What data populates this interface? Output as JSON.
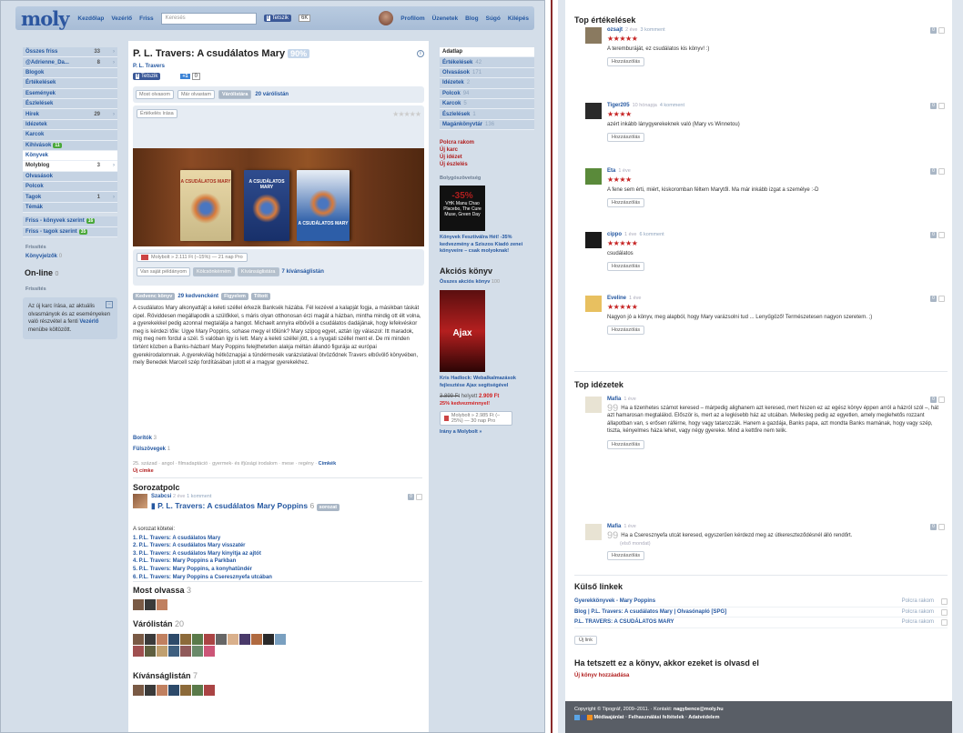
{
  "left": {
    "topbar": {
      "logo": "moly",
      "links": [
        "Kezdőlap",
        "Vezérlő",
        "Friss"
      ],
      "search_placeholder": "Keresés",
      "tetszik": "Tetszik",
      "count": "6K",
      "profile": "Profilom",
      "right_links": [
        "Üzenetek",
        "Blog",
        "Súgó",
        "Kilépés"
      ]
    },
    "sidebar": {
      "items": [
        {
          "label": "Összes friss",
          "n": "33"
        },
        {
          "label": "@Adrienne_Da...",
          "n": "8"
        },
        {
          "label": "Blogok",
          "n": ""
        },
        {
          "label": "Értékelések",
          "n": ""
        },
        {
          "label": "Események",
          "n": ""
        },
        {
          "label": "Észlelések",
          "n": ""
        },
        {
          "label": "Hírek",
          "n": "29"
        },
        {
          "label": "Idézetek",
          "n": ""
        },
        {
          "label": "Karcok",
          "n": ""
        },
        {
          "label": "Kihívások",
          "n": "",
          "badge": "11"
        },
        {
          "label": "Könyvek",
          "n": "",
          "hi": true
        },
        {
          "label": "Molyblog",
          "n": "3",
          "white": true
        },
        {
          "label": "Olvasások",
          "n": ""
        },
        {
          "label": "Polcok",
          "n": ""
        },
        {
          "label": "Tagok",
          "n": "1"
        },
        {
          "label": "Témák",
          "n": ""
        }
      ],
      "extra": [
        {
          "label": "Friss - könyvek szerint",
          "badge": "16"
        },
        {
          "label": "Friss - tagok szerint",
          "badge": "35"
        }
      ],
      "friends_head": "Frissítés",
      "konyvjelzok": "Könyvjelzők",
      "konyvjelzok_n": "0",
      "online": "On-line",
      "online_n": "0",
      "friends_head2": "Frissítés",
      "info": "Az új karc írása, az aktuális olvasmányok és az eseményeken való részvétel a fenti",
      "info_link": "Vezérlő",
      "info_end": "menübe költözött."
    },
    "book": {
      "title": "P. L. Travers: A csudálatos Mary",
      "pct": "90%",
      "author": "P. L. Travers",
      "tetszik": "Tetszik",
      "gplus": "+1",
      "gcount": "0",
      "status_btns": [
        "Most olvasom",
        "Már olvastam",
        "Várólistára"
      ],
      "varolistan": "20 várólistán",
      "rate_btn": "Értékelés írása",
      "book_titles": [
        "A CSUDÁLATOS MARY",
        "A CSUDÁLATOS MARY",
        "A CSUDÁLATOS MARY"
      ],
      "molybolt": "Molybolt » 2.111 Ft (–15%) — 21 nap Pro",
      "own_btns": [
        "Van saját példányom",
        "Kölcsönkérném",
        "Kívánságlistára"
      ],
      "kivansag": "7 kívánságlistán",
      "tags": [
        "Kedvenc könyv",
        "29 kedvencként",
        "Figyelem",
        "Tiltott"
      ],
      "desc": "A csudálatos Mary alkonyattájt a keleti széllel érkezik Banksék házába. Fél kezével a kalapját fogja, a másikban táskát cipel. Röviddesen megállapodik a szülőkkel, s máris olyan otthonosan érzi magát a házban, mintha mindig ott élt volna, a gyerekekkel pedig azonnal megtalálja a hangot. Michaelt annyira elbűvöli a csudálatos dadájának, hogy lefekvéskor meg is kérdezi tőle: Ugye Mary Poppins, sohase megy el tőlünk? Mary szipog egyet, aztán így válaszol: Itt maradok, míg meg nem fordul a szél. S valóban így is lett. Mary a keleti széllel jött, s a nyugati széllel ment el. De mi minden történt közben a Banks-házban! Mary Poppins felejthetetlen alakja méltán állandó figurája az európai gyerekirodalomnak. A gyerekvilág hétköznapjai a tündérmesék varázslatával ötvöződnek Travers elbűvölő könyvében, mely Benedek Marcell szép fordításában jutott el a magyar gyerekekhez.",
      "borito": "Borítók",
      "borito_n": "3",
      "kiadas": "Fülszövegek",
      "kiadas_n": "1",
      "cats": "25. század · angol · filmadaptáció · gyermek- és ifjúsági irodalom · mese · regény ·",
      "cimkek": "Címkék",
      "uj_cimke": "Új címke"
    },
    "series": {
      "head": "Sorozatpolc",
      "user": "Szabcsi",
      "meta": "2 éve",
      "comments": "1 komment",
      "title": "P. L. Travers: A csudálatos Mary Poppins",
      "count": "6",
      "list_head": "A sorozat kötetei:",
      "list": [
        "1. P.L. Travers: A csudálatos Mary",
        "2. P.L. Travers: A csudálatos Mary visszatér",
        "3. P.L. Travers: A csudálatos Mary kinyitja az ajtót",
        "4. P.L. Travers: Mary Poppins a Parkban",
        "5. P.L. Travers: Mary Poppins, a konyhatündér",
        "6. P.L. Travers: Mary Poppins a Cseresznyefa utcában"
      ]
    },
    "reading": {
      "head": "Most olvassa",
      "n": "3"
    },
    "waiting": {
      "head": "Várólistán",
      "n": "20"
    },
    "wish": {
      "head": "Kívánságlistán",
      "n": "7"
    },
    "adatlap": {
      "head": "Adatlap",
      "items": [
        {
          "label": "Értékelések",
          "n": "42"
        },
        {
          "label": "Olvasások",
          "n": "171"
        },
        {
          "label": "Idézetek",
          "n": "2"
        },
        {
          "label": "Polcok",
          "n": "94"
        },
        {
          "label": "Karcok",
          "n": "5"
        },
        {
          "label": "Észlelések",
          "n": "1"
        },
        {
          "label": "Magánkönyvtár",
          "n": "136"
        }
      ],
      "red_links": [
        "Polcra rakom",
        "Új karc",
        "Új idézet",
        "Új észlelés"
      ],
      "ad_head": "Bolygószövetség",
      "ad_big": "-35%",
      "ad_text": "VHK Manu Chao Placebo, The Cure Muse, Green Day",
      "ad_link": "Könyvek Fesztiválra Hét! -35% kedvezmény a Sziszos Kiadó zenei könyveire – csak molyoknak!",
      "akcios": "Akciós könyv",
      "osszes_akcios": "Összes akciós könyv",
      "osszes_n": "100",
      "ajax": "Ajax",
      "ajax_title": "Kris Hadlock: Webalkalmazások fejlesztése Ajax segítségével",
      "old_price": "3.899 Ft",
      "helyett": "helyett",
      "new_price": "2.909 Ft",
      "discount": "25% kedvezménnyel!",
      "mb_btn": "Molybolt » 2.985 Ft (–25%) — 30 nap Pro",
      "irany": "Irány a Molybolt »"
    }
  },
  "right": {
    "top_reviews_head": "Top értékelések",
    "reviews": [
      {
        "user": "ozsajt",
        "meta": "2 éve",
        "comments": "3 komment",
        "stars": "★★★★★",
        "text": "A teremburáját, ez csudálatos kis könyv! :)",
        "reply": "Hozzászólás"
      },
      {
        "user": "Tiger205",
        "meta": "10 hónapja",
        "comments": "4 komment",
        "stars": "★★★★",
        "text": "azért inkább lánygyerekeknek való (Mary vs Winnetou)",
        "reply": "Hozzászólás"
      },
      {
        "user": "Eta",
        "meta": "1 éve",
        "comments": "",
        "stars": "★★★★",
        "text": "A fene sem érti, miért, kiskoromban féltem Marytől. Ma már inkább izgat a személye :-D",
        "reply": "Hozzászólás"
      },
      {
        "user": "cippo",
        "meta": "1 éve",
        "comments": "6 komment",
        "stars": "★★★★★",
        "text": "csudálatos",
        "reply": "Hozzászólás"
      },
      {
        "user": "Eveline",
        "meta": "1 éve",
        "comments": "",
        "stars": "★★★★★",
        "text": "Nagyon jó a könyv, meg alapból, hogy Mary varázsolni tud ... Lenyűgöző! Természetesen nagyon szeretem. ;)",
        "reply": "Hozzászólás"
      }
    ],
    "quotes_head": "Top idézetek",
    "quotes": [
      {
        "user": "Mafia",
        "meta": "1 éve",
        "text": "Ha a tizenhetes számot keresed – márpedig alighanem azt keresed, mert hiszen ez az egész könyv éppen arról a házról szól –, hát azt hamarosan megtalálod. Először is, mert az a legkisebb ház az utcában. Mellesleg pedig az egyetlen, amely meglehetős rozzant állapotban van, s erősen ráférne, hogy vagy tatarozzák. Hanem a gazdája, Banks papa, azt mondta Banks mamának, hogy vagy szép, tiszta, kényelmes háza lehet, vagy négy gyereke. Mind a kettőre nem telik.",
        "source": "",
        "reply": "Hozzászólás"
      },
      {
        "user": "Mafia",
        "meta": "1 éve",
        "text": "Ha a Cseresznyefa utcát keresed, egyszerűen kérdezd meg az útkereszteződésnél álló rendőrt.",
        "source": "(első mondat)",
        "reply": "Hozzászólás"
      }
    ],
    "ext_head": "Külső linkek",
    "ext": [
      {
        "label": "Gyerekkönyvek - Mary Poppins",
        "r": "Polcra rakom"
      },
      {
        "label": "Blog | P.L. Travers: A csudálatos Mary | Olvasónapló [SPG]",
        "r": "Polcra rakom"
      },
      {
        "label": "P.L. TRAVERS: A CSUDÁLATOS MARY",
        "r": "Polcra rakom"
      }
    ],
    "uj_link": "Új link",
    "also_head": "Ha tetszett ez a könyv, akkor ezeket is olvasd el",
    "also_link": "Új könyv hozzáadása",
    "footer1": "Copyright © Tipográf, 2009–2011. · Kontakt:",
    "footer_mail": "nagybence@moly.hu",
    "footer_links": "Médiaajánlat · Felhasználási feltételek · Adatvédelem"
  }
}
